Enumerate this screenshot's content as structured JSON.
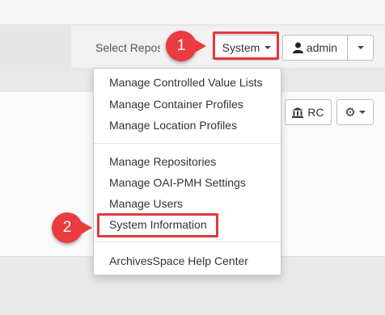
{
  "header": {
    "select_repo_label": "Select Repository",
    "system_button": "System",
    "user_button": "admin"
  },
  "toolbar": {
    "repo_button": "RC"
  },
  "system_menu": {
    "items": [
      "Manage Controlled Value Lists",
      "Manage Container Profiles",
      "Manage Location Profiles",
      "Manage Repositories",
      "Manage OAI-PMH Settings",
      "Manage Users",
      "System Information",
      "ArchivesSpace Help Center"
    ]
  },
  "callouts": {
    "step1": "1",
    "step2": "2",
    "color": "#e0393e"
  },
  "icons": [
    "user-icon",
    "bank-icon",
    "gear-icon",
    "caret-down-icon"
  ]
}
